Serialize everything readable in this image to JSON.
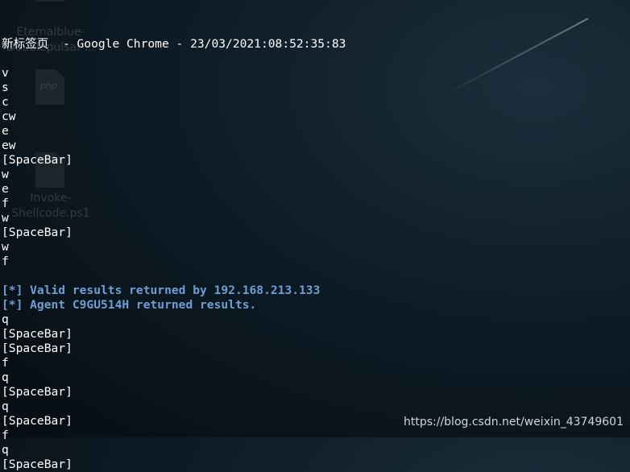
{
  "window_title": "新标签页  - Google Chrome - 23/03/2021:08:52:35:83",
  "desktop_icons": [
    {
      "label_line1": "Eternalblue-",
      "label_line2": "Doublepulsar-...",
      "icon": "folder-icon"
    },
    {
      "label": "php",
      "icon": "php-file-icon"
    },
    {
      "label_line1": "Invoke-",
      "label_line2": "Shellcode.ps1",
      "icon": "text-file-icon"
    }
  ],
  "lines_before": [
    "v",
    "s",
    "c",
    "cw",
    "e",
    "ew",
    "[SpaceBar]",
    "w",
    "e",
    "f",
    "w",
    "[SpaceBar]",
    "w",
    "f"
  ],
  "info_lines": [
    "[*] Valid results returned by 192.168.213.133",
    "[*] Agent C9GU514H returned results."
  ],
  "lines_after": [
    "q",
    "[SpaceBar]",
    "[SpaceBar]",
    "f",
    "q",
    "[SpaceBar]",
    "q",
    "[SpaceBar]",
    "f",
    "q",
    "[SpaceBar]"
  ],
  "info_color": "#6d9fd4",
  "watermark": "https://blog.csdn.net/weixin_43749601"
}
